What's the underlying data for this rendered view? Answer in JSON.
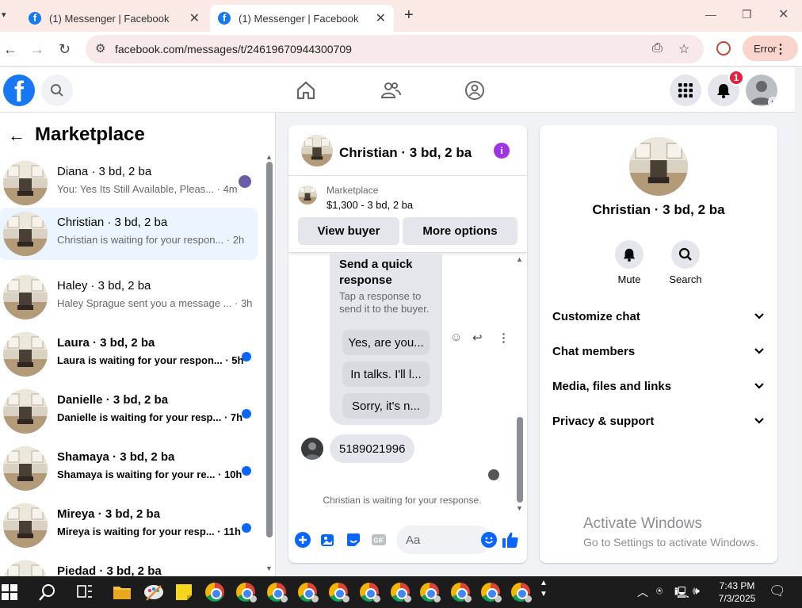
{
  "browser": {
    "tabs": [
      {
        "title": "(1) Messenger | Facebook",
        "active": false
      },
      {
        "title": "(1) Messenger | Facebook",
        "active": true
      }
    ],
    "url": "facebook.com/messages/t/24619670944300709",
    "error_label": "Error"
  },
  "facebook": {
    "notification_count": "1"
  },
  "sidebar": {
    "title": "Marketplace",
    "conversations": [
      {
        "name": "Diana · 3 bd, 2 ba",
        "preview": "You: Yes Its Still Available, Pleas... · 4m",
        "unread": false
      },
      {
        "name": "Christian · 3 bd, 2 ba",
        "preview": "Christian is waiting for your respon... · 2h",
        "unread": false
      },
      {
        "name": "Haley · 3 bd, 2 ba",
        "preview": "Haley Sprague sent you a message ... · 3h",
        "unread": false
      },
      {
        "name": "Laura · 3 bd, 2 ba",
        "preview": "Laura is waiting for your respon... · 5h",
        "unread": true
      },
      {
        "name": "Danielle · 3 bd, 2 ba",
        "preview": "Danielle is waiting for your resp... · 7h",
        "unread": true
      },
      {
        "name": "Shamaya · 3 bd, 2 ba",
        "preview": "Shamaya is waiting for your re... · 10h",
        "unread": true
      },
      {
        "name": "Mireya · 3 bd, 2 ba",
        "preview": "Mireya is waiting for your resp... · 11h",
        "unread": true
      },
      {
        "name": "Piedad · 3 bd, 2 ba",
        "preview": "",
        "unread": true
      }
    ]
  },
  "chat": {
    "name": "Christian · 3 bd, 2 ba",
    "marketplace_label": "Marketplace",
    "listing": "$1,300 - 3 bd, 2 ba",
    "view_buyer": "View buyer",
    "more_options": "More options",
    "quick_title": "Send a quick response",
    "quick_sub": "Tap a response to send it to the buyer.",
    "quick_options": [
      "Yes, are you...",
      "In talks. I'll l...",
      "Sorry, it's n..."
    ],
    "phone_message": "5189021996",
    "waiting_text": "Christian is waiting for your response.",
    "input_placeholder": "Aa"
  },
  "panel": {
    "name": "Christian · 3 bd, 2 ba",
    "mute_label": "Mute",
    "search_label": "Search",
    "sections": [
      "Customize chat",
      "Chat members",
      "Media, files and links",
      "Privacy & support"
    ]
  },
  "watermark": {
    "line1": "Activate Windows",
    "line2": "Go to Settings to activate Windows."
  },
  "taskbar": {
    "time": "7:43 PM",
    "date": "7/3/2025"
  }
}
